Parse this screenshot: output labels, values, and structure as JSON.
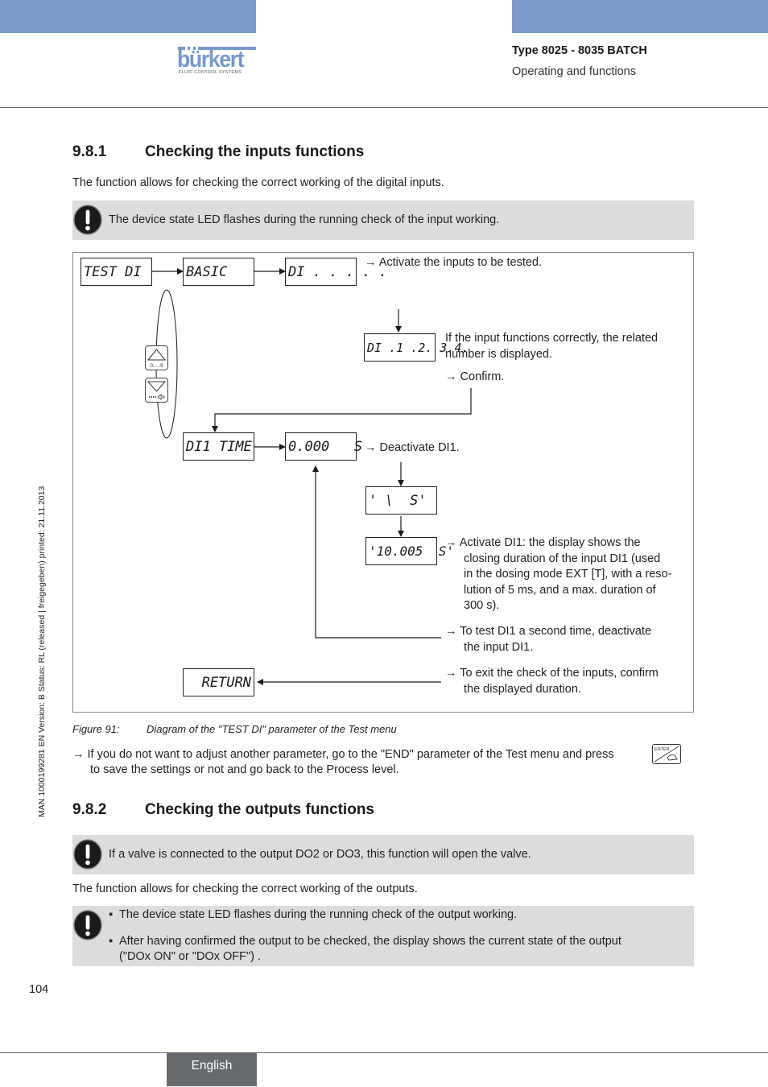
{
  "header": {
    "logo_word": "bürkert",
    "logo_sub": "FLUID CONTROL SYSTEMS",
    "type": "Type 8025 - 8035 BATCH",
    "subtitle": "Operating and functions",
    "brand_color": "#7899c9"
  },
  "side_label": "MAN  1000199281  EN  Version: B  Status: RL (released | freigegeben)  printed: 21.11.2013",
  "section1": {
    "number": "9.8.1",
    "title": "Checking the inputs functions",
    "intro": "The function allows for checking the correct working of the digital inputs.",
    "note": "The device state LED flashes during the running check of the input working."
  },
  "diagram": {
    "displays": {
      "test_di": "TEST DI",
      "basic": "BASIC",
      "di_dots": "DI . . . . .",
      "di_numbers": "DI .1 .2. 3.4.",
      "di1_time": "DI1 TIME",
      "zero_time": "0.000   S",
      "running": "' \\  S'",
      "measured": "'10.005  S'",
      "return": "RETURN"
    },
    "keys": {
      "up_label": "0.....9",
      "down_label": "⟸"
    },
    "texts": {
      "activate_inputs": "→ Activate the inputs to be tested.",
      "if_input_line1": "If the input functions correctly, the related",
      "if_input_line2": "number is displayed.",
      "confirm": "→ Confirm.",
      "deactivate": "→ Deactivate DI1.",
      "activate_di1": [
        "→ Activate DI1: the display shows the",
        "closing duration of the input DI1 (used",
        "in the dosing mode EXT [T], with a reso-",
        "lution of 5 ms, and a max. duration of",
        "300 s)."
      ],
      "test_again": [
        "→ To test DI1 a second time, deactivate",
        "the input DI1."
      ],
      "exit": [
        "→ To exit the check of the inputs, confirm",
        "the displayed duration."
      ]
    }
  },
  "caption": {
    "figure": "Figure 91:",
    "text": "Diagram of the \"TEST DI\" parameter of the Test menu"
  },
  "end_instruction": {
    "line1": "→ If you do not want to adjust another parameter, go to the \"END\" parameter of the Test menu and press",
    "line2": "to save the settings or not and go back to the Process level.",
    "key_label": "ENTER"
  },
  "section2": {
    "number": "9.8.2",
    "title": "Checking the outputs functions",
    "note": "If a valve is connected to the output DO2 or DO3, this function will open the valve.",
    "intro": "The function allows for checking the correct working of the outputs.",
    "bullets": [
      "The device state LED flashes during the running check of the output working.",
      "After having confirmed the output to be checked, the display shows the current state of the output",
      "(\"DOx ON\" or \"DOx OFF\") ."
    ]
  },
  "footer": {
    "page_number": "104",
    "language": "English"
  }
}
